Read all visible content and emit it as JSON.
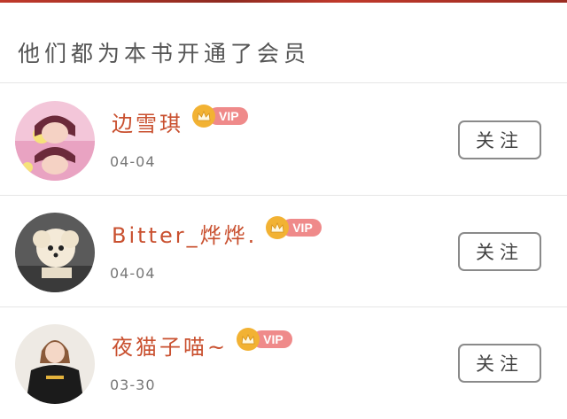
{
  "section": {
    "title": "他们都为本书开通了会员"
  },
  "members": [
    {
      "name": "边雪琪",
      "badge": "VIP",
      "date": "04-04",
      "follow_label": "关注"
    },
    {
      "name": "Bitter_烨烨.",
      "badge": "VIP",
      "date": "04-04",
      "follow_label": "关注"
    },
    {
      "name": "夜猫子喵~",
      "badge": "VIP",
      "date": "03-30",
      "follow_label": "关注"
    }
  ],
  "colors": {
    "name": "#c9502f",
    "vip_pill": "#ef8a8a",
    "crown": "#f2b233",
    "accent_strip": "#c0392b"
  }
}
